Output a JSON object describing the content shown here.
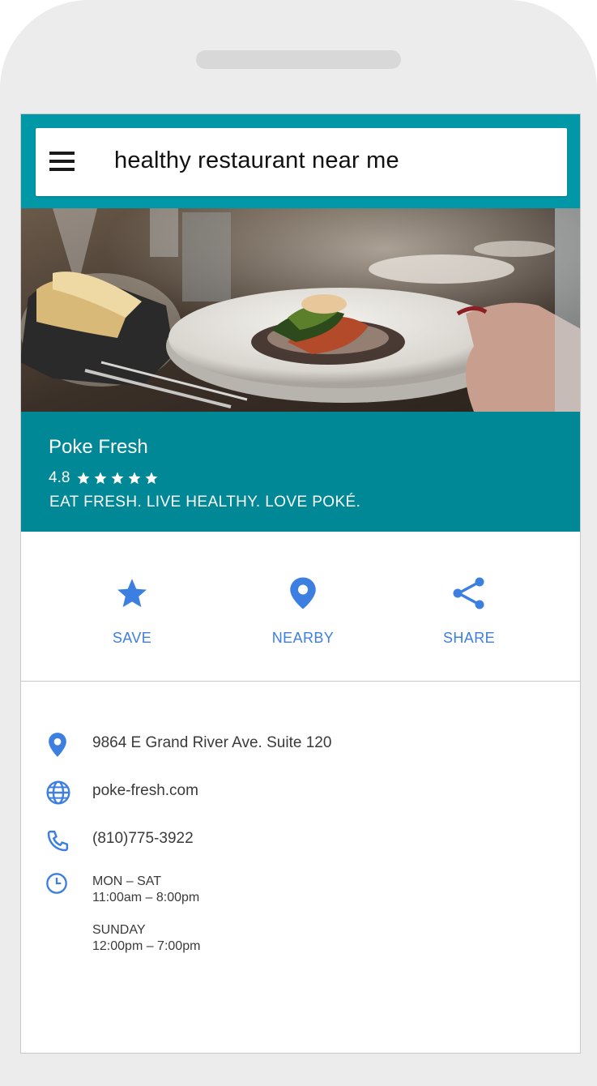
{
  "search": {
    "query": "healthy restaurant near me"
  },
  "place": {
    "name": "Poke Fresh",
    "rating": "4.8",
    "stars": 5,
    "tagline": "EAT FRESH. LIVE HEALTHY. LOVE POKÉ."
  },
  "actions": [
    {
      "label": "SAVE",
      "icon": "star-icon"
    },
    {
      "label": "NEARBY",
      "icon": "location-pin-icon"
    },
    {
      "label": "SHARE",
      "icon": "share-icon"
    }
  ],
  "details": {
    "address": "9864 E Grand River Ave. Suite 120",
    "website": "poke-fresh.com",
    "phone": "(810)775-3922",
    "hours": [
      {
        "days": "MON – SAT",
        "time": "11:00am – 8:00pm"
      },
      {
        "days": "SUNDAY",
        "time": "12:00pm – 7:00pm"
      }
    ]
  },
  "colors": {
    "header_teal": "#0097a7",
    "info_teal": "#008897",
    "accent_blue": "#3d7fe0"
  }
}
